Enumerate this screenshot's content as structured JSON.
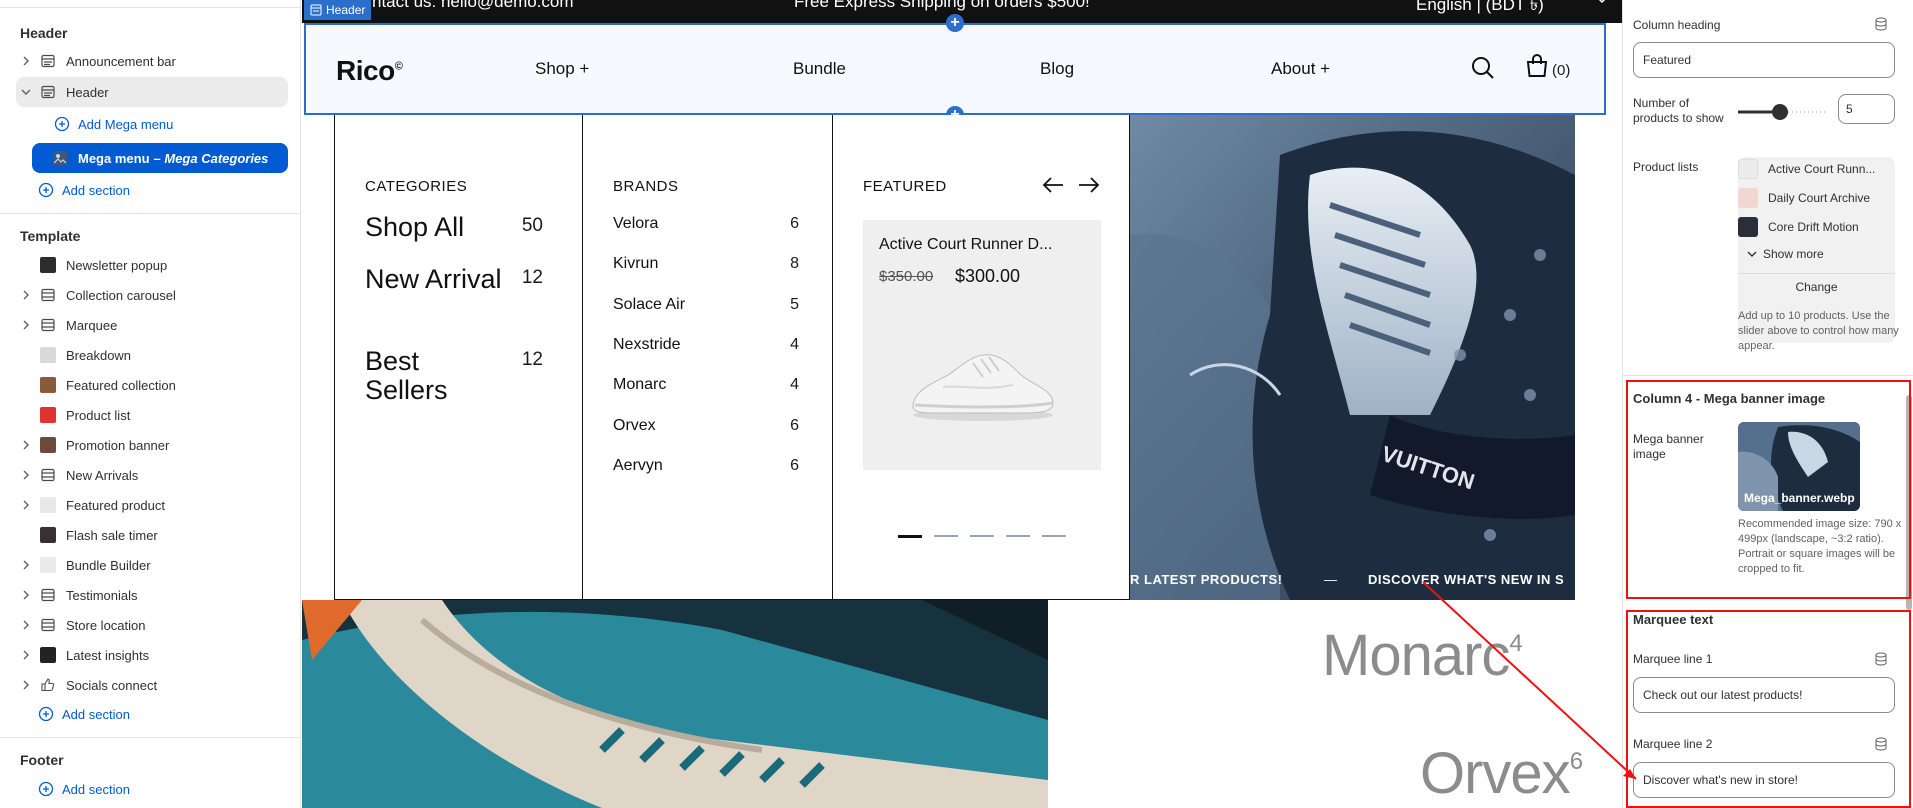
{
  "sidebar": {
    "header_group": "Header",
    "header_items": [
      {
        "label": "Announcement bar"
      },
      {
        "label": "Header"
      }
    ],
    "add_mega_menu": "Add Mega menu",
    "active_block": {
      "label": "Mega menu",
      "dash": " – ",
      "sub": "Mega Categories"
    },
    "add_section_1": "Add section",
    "template_group": "Template",
    "template_items": [
      {
        "label": "Newsletter popup",
        "chevron": false
      },
      {
        "label": "Collection carousel",
        "chevron": true
      },
      {
        "label": "Marquee",
        "chevron": true
      },
      {
        "label": "Breakdown",
        "chevron": false
      },
      {
        "label": "Featured collection",
        "chevron": false
      },
      {
        "label": "Product list",
        "chevron": false
      },
      {
        "label": "Promotion banner",
        "chevron": true
      },
      {
        "label": "New Arrivals",
        "chevron": true
      },
      {
        "label": "Featured product",
        "chevron": true
      },
      {
        "label": "Flash sale timer",
        "chevron": false
      },
      {
        "label": "Bundle Builder",
        "chevron": true
      },
      {
        "label": "Testimonials",
        "chevron": true
      },
      {
        "label": "Store location",
        "chevron": true
      },
      {
        "label": "Latest insights",
        "chevron": true
      },
      {
        "label": "Socials connect",
        "chevron": true
      }
    ],
    "add_section_2": "Add section",
    "footer_group": "Footer",
    "add_section_3": "Add section"
  },
  "preview": {
    "announcement": {
      "left": "ntact us: hello@demo.com",
      "center": "Free Express Shipping on orders $500!",
      "right": "English | (BDT ৳)"
    },
    "header_tag": "Header",
    "logo": "Rico",
    "logo_mark": "©",
    "nav": [
      "Shop +",
      "Bundle",
      "Blog",
      "About +"
    ],
    "cart_count": "(0)",
    "mega": {
      "categories_title": "CATEGORIES",
      "categories": [
        {
          "name": "Shop All",
          "count": "50"
        },
        {
          "name": "New Arrival",
          "count": "12"
        },
        {
          "name": "Best Sellers",
          "count": "12"
        }
      ],
      "brands_title": "BRANDS",
      "brands": [
        {
          "name": "Velora",
          "count": "6"
        },
        {
          "name": "Kivrun",
          "count": "8"
        },
        {
          "name": "Solace Air",
          "count": "5"
        },
        {
          "name": "Nexstride",
          "count": "4"
        },
        {
          "name": "Monarc",
          "count": "4"
        },
        {
          "name": "Orvex",
          "count": "6"
        },
        {
          "name": "Aervyn",
          "count": "6"
        }
      ],
      "featured_title": "FEATURED",
      "product": {
        "name": "Active Court Runner D...",
        "old_price": "$350.00",
        "price": "$300.00"
      },
      "carousel_dots": 5,
      "banner_text_shoe": "VUITTON",
      "marquee": {
        "left": "R LATEST PRODUCTS!",
        "sep": "—",
        "right": "DISCOVER WHAT'S NEW IN S"
      }
    },
    "big_brands": [
      {
        "name": "Monarc",
        "count": "4"
      },
      {
        "name": "Orvex",
        "count": "6"
      }
    ]
  },
  "right_panel": {
    "column_heading_label": "Column heading",
    "column_heading_value": "Featured",
    "num_products_label": "Number of products to show",
    "num_products_value": "5",
    "product_lists_label": "Product lists",
    "product_list": [
      {
        "name": "Active Court Runn..."
      },
      {
        "name": "Daily Court Archive"
      },
      {
        "name": "Core Drift Motion"
      }
    ],
    "show_more": "Show more",
    "change": "Change",
    "products_hint": "Add up to 10 products. Use the slider above to control how many appear.",
    "col4_title": "Column 4 - Mega banner image",
    "mega_banner_label": "Mega banner image",
    "mega_banner_file": "Mega_banner.webp",
    "mega_banner_hint": "Recommended image size: 790 x 499px (landscape, ~3:2 ratio). Portrait or square images will be cropped to fit.",
    "marquee_title": "Marquee text",
    "marquee_line1_label": "Marquee line 1",
    "marquee_line1_value": "Check out our latest products!",
    "marquee_line2_label": "Marquee line 2",
    "marquee_line2_value": "Discover what's new in store!"
  },
  "colors": {
    "accent": "#005bd3",
    "editor_outline": "#2c6ecb",
    "annotation": "#e11111"
  }
}
